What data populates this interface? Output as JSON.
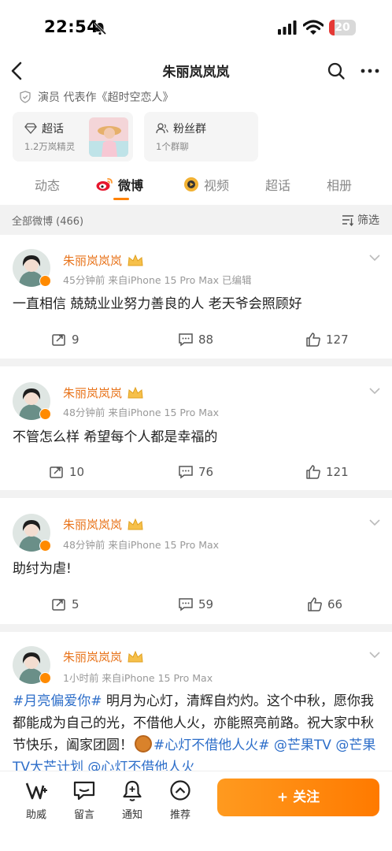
{
  "status_bar": {
    "time": "22:54",
    "battery_level": "20",
    "battery_fraction": 0.2
  },
  "nav": {
    "title": "朱丽岚岚岚"
  },
  "profile": {
    "role_line": "演员 代表作《超时空恋人》",
    "chaohua_card": {
      "title": "超话",
      "sub": "1.2万岚精灵"
    },
    "fans_card": {
      "title": "粉丝群",
      "sub": "1个群聊"
    }
  },
  "tabs": [
    {
      "label": "动态"
    },
    {
      "label": "微博"
    },
    {
      "label": "视频"
    },
    {
      "label": "超话"
    },
    {
      "label": "相册"
    }
  ],
  "filter": {
    "count_label": "全部微博 (466)",
    "filter_label": "筛选"
  },
  "posts": [
    {
      "author": "朱丽岚岚岚",
      "meta": "45分钟前  来自iPhone 15 Pro Max  已编辑",
      "text": "一直相信 兢兢业业努力善良的人 老天爷会照顾好",
      "reposts": "9",
      "comments": "88",
      "likes": "127"
    },
    {
      "author": "朱丽岚岚岚",
      "meta": "48分钟前  来自iPhone 15 Pro Max",
      "text": "不管怎么样 希望每个人都是幸福的",
      "reposts": "10",
      "comments": "76",
      "likes": "121"
    },
    {
      "author": "朱丽岚岚岚",
      "meta": "48分钟前  来自iPhone 15 Pro Max",
      "text": "助纣为虐!",
      "reposts": "5",
      "comments": "59",
      "likes": "66"
    },
    {
      "author": "朱丽岚岚岚",
      "meta": "1小时前  来自iPhone 15 Pro Max",
      "hashtag1": "#月亮偏爱你#",
      "text_body": " 明月为心灯，清辉自灼灼。这个中秋，愿你我都能成为自己的光，不借他人火，亦能照亮前路。祝大家中秋节快乐，阖家团圆！",
      "hashtag2": "#心灯不借他人火#",
      "mentions": " @芒果TV @芒果TV大芒计划 @心灯不借他人火"
    }
  ],
  "bottom_bar": {
    "items": [
      {
        "label": "助威"
      },
      {
        "label": "留言"
      },
      {
        "label": "通知"
      },
      {
        "label": "推荐"
      }
    ],
    "follow_label": "+ 关注"
  },
  "colors": {
    "accent_orange": "#ff8200",
    "author_orange": "#e8741c",
    "link_blue": "#2d6ec9"
  }
}
